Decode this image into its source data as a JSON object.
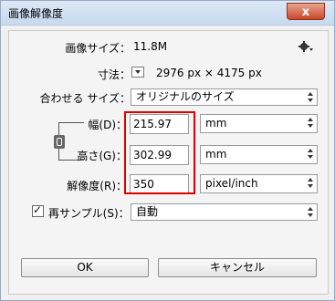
{
  "window": {
    "title": "画像解像度",
    "close_label": "x"
  },
  "image_size": {
    "label": "画像サイズ：",
    "value": "11.8M"
  },
  "dimensions": {
    "label": "寸法：",
    "value": "2976 px × 4175 px"
  },
  "fit_to": {
    "label": "合わせる サイズ：",
    "selected": "オリジナルのサイズ"
  },
  "width": {
    "label": "幅(D)：",
    "value": "215.97",
    "unit": "mm"
  },
  "height": {
    "label": "高さ(G)：",
    "value": "302.99",
    "unit": "mm"
  },
  "resolution": {
    "label": "解像度(R)：",
    "value": "350",
    "unit": "pixel/inch"
  },
  "resample": {
    "label": "再サンプル(S)：",
    "checked": true,
    "selected": "自動"
  },
  "buttons": {
    "ok": "OK",
    "cancel": "キャンセル"
  },
  "icons": {
    "gear": "gear-icon",
    "link": "chain-link-icon",
    "dim_toggle": "dropdown-triangle-icon"
  },
  "colors": {
    "highlight": "#e00000"
  }
}
